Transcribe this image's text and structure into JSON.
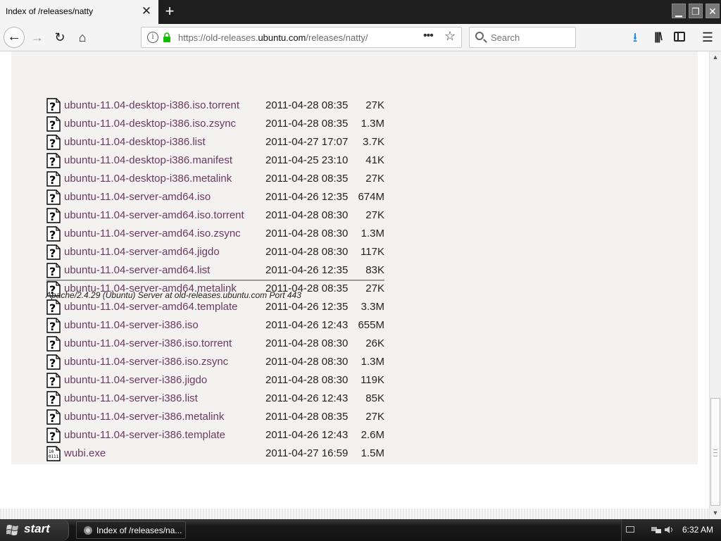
{
  "browser": {
    "tab_title": "Index of /releases/natty",
    "url_prefix": "https://old-releases.",
    "url_domain": "ubuntu.com",
    "url_path": "/releases/natty/",
    "search_placeholder": "Search",
    "accent_color": "#0a84ff"
  },
  "listing": {
    "link_color": "#6b3a5e",
    "files": [
      {
        "name": "ubuntu-11.04-desktop-i386.iso.torrent",
        "date": "2011-04-28 08:35",
        "size": "27K",
        "icon": "unknown-file-icon"
      },
      {
        "name": "ubuntu-11.04-desktop-i386.iso.zsync",
        "date": "2011-04-28 08:35",
        "size": "1.3M",
        "icon": "unknown-file-icon"
      },
      {
        "name": "ubuntu-11.04-desktop-i386.list",
        "date": "2011-04-27 17:07",
        "size": "3.7K",
        "icon": "unknown-file-icon"
      },
      {
        "name": "ubuntu-11.04-desktop-i386.manifest",
        "date": "2011-04-25 23:10",
        "size": "41K",
        "icon": "unknown-file-icon"
      },
      {
        "name": "ubuntu-11.04-desktop-i386.metalink",
        "date": "2011-04-28 08:35",
        "size": "27K",
        "icon": "unknown-file-icon"
      },
      {
        "name": "ubuntu-11.04-server-amd64.iso",
        "date": "2011-04-26 12:35",
        "size": "674M",
        "icon": "unknown-file-icon"
      },
      {
        "name": "ubuntu-11.04-server-amd64.iso.torrent",
        "date": "2011-04-28 08:30",
        "size": "27K",
        "icon": "unknown-file-icon"
      },
      {
        "name": "ubuntu-11.04-server-amd64.iso.zsync",
        "date": "2011-04-28 08:30",
        "size": "1.3M",
        "icon": "unknown-file-icon"
      },
      {
        "name": "ubuntu-11.04-server-amd64.jigdo",
        "date": "2011-04-28 08:30",
        "size": "117K",
        "icon": "unknown-file-icon"
      },
      {
        "name": "ubuntu-11.04-server-amd64.list",
        "date": "2011-04-26 12:35",
        "size": "83K",
        "icon": "unknown-file-icon"
      },
      {
        "name": "ubuntu-11.04-server-amd64.metalink",
        "date": "2011-04-28 08:35",
        "size": "27K",
        "icon": "unknown-file-icon"
      },
      {
        "name": "ubuntu-11.04-server-amd64.template",
        "date": "2011-04-26 12:35",
        "size": "3.3M",
        "icon": "unknown-file-icon"
      },
      {
        "name": "ubuntu-11.04-server-i386.iso",
        "date": "2011-04-26 12:43",
        "size": "655M",
        "icon": "unknown-file-icon"
      },
      {
        "name": "ubuntu-11.04-server-i386.iso.torrent",
        "date": "2011-04-28 08:30",
        "size": "26K",
        "icon": "unknown-file-icon"
      },
      {
        "name": "ubuntu-11.04-server-i386.iso.zsync",
        "date": "2011-04-28 08:30",
        "size": "1.3M",
        "icon": "unknown-file-icon"
      },
      {
        "name": "ubuntu-11.04-server-i386.jigdo",
        "date": "2011-04-28 08:30",
        "size": "119K",
        "icon": "unknown-file-icon"
      },
      {
        "name": "ubuntu-11.04-server-i386.list",
        "date": "2011-04-26 12:43",
        "size": "85K",
        "icon": "unknown-file-icon"
      },
      {
        "name": "ubuntu-11.04-server-i386.metalink",
        "date": "2011-04-28 08:35",
        "size": "27K",
        "icon": "unknown-file-icon"
      },
      {
        "name": "ubuntu-11.04-server-i386.template",
        "date": "2011-04-26 12:43",
        "size": "2.6M",
        "icon": "unknown-file-icon"
      },
      {
        "name": "wubi.exe",
        "date": "2011-04-27 16:59",
        "size": "1.5M",
        "icon": "binary-file-icon"
      }
    ],
    "footer": "Apache/2.4.29 (Ubuntu) Server at old-releases.ubuntu.com Port 443"
  },
  "taskbar": {
    "start_label": "start",
    "task_label": "Index of /releases/na...",
    "clock": "6:32 AM"
  }
}
